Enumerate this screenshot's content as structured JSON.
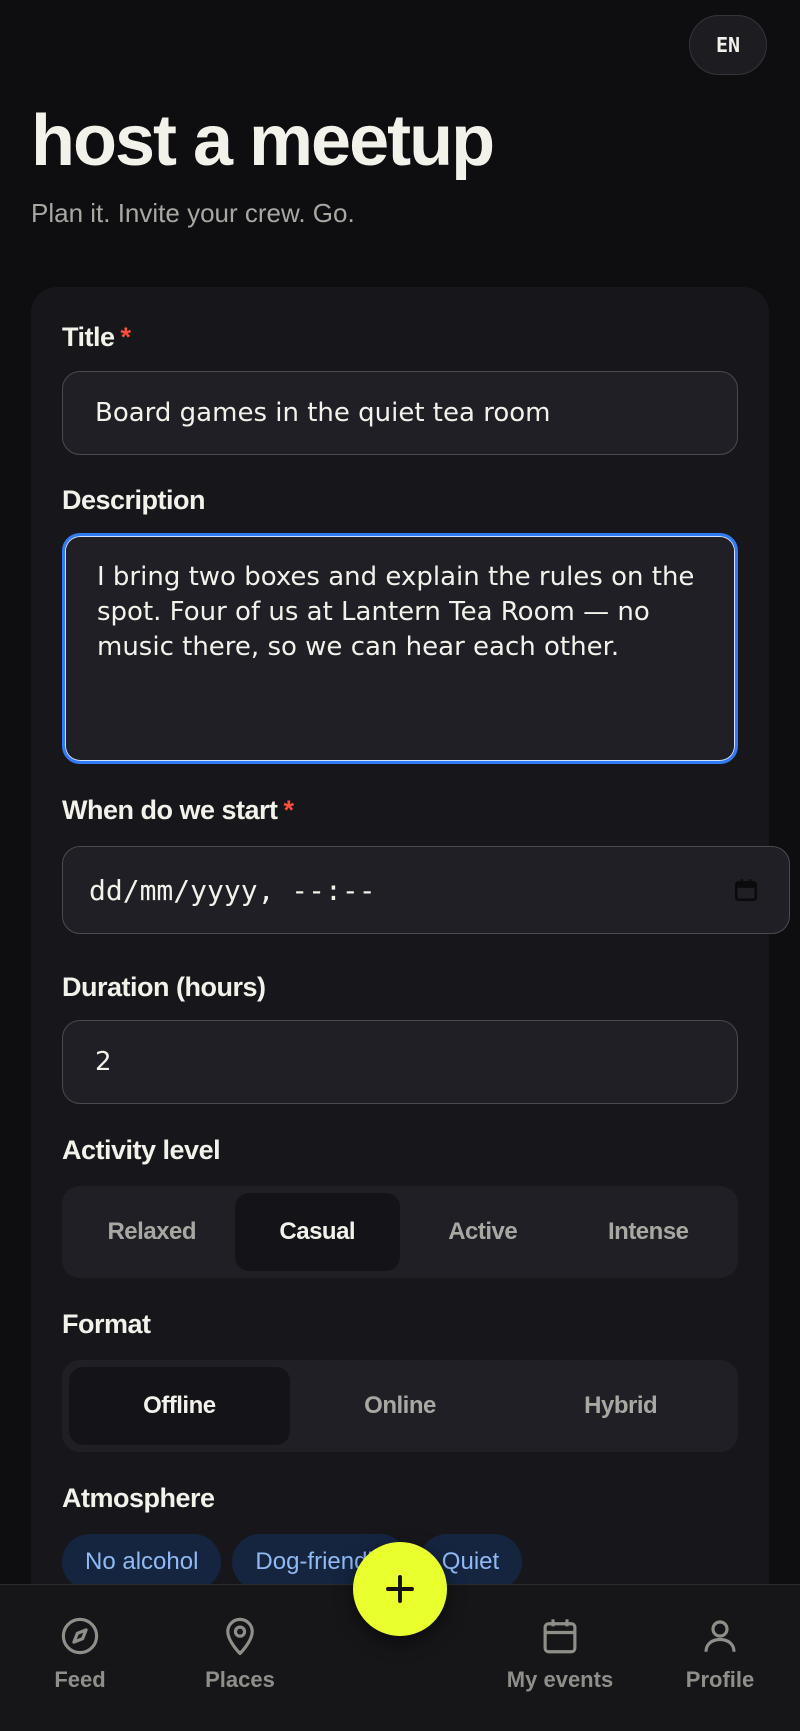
{
  "header": {
    "lang": "EN",
    "title": "host a meetup",
    "subtitle": "Plan it. Invite your crew. Go."
  },
  "form": {
    "title_label": "Title",
    "title_required": "*",
    "title_value": "Board games in the quiet tea room",
    "description_label": "Description",
    "description_value": "I bring two boxes and explain the rules on the spot. Four of us at Lantern Tea Room — no music there, so we can hear each other.",
    "start_label": "When do we start",
    "start_required": "*",
    "start_placeholder": "dd/mm/yyyy, --:--",
    "duration_label": "Duration (hours)",
    "duration_value": "2",
    "activity_label": "Activity level",
    "activity_options": [
      "Relaxed",
      "Casual",
      "Active",
      "Intense"
    ],
    "activity_selected": "Casual",
    "format_label": "Format",
    "format_options": [
      "Offline",
      "Online",
      "Hybrid"
    ],
    "format_selected": "Offline",
    "atmosphere_label": "Atmosphere",
    "atmosphere_chips": [
      "No alcohol",
      "Dog-friendly",
      "Quiet"
    ]
  },
  "nav": {
    "items": [
      {
        "label": "Feed",
        "icon": "compass-icon"
      },
      {
        "label": "Places",
        "icon": "map-pin-icon"
      },
      {
        "label": "My events",
        "icon": "calendar-icon"
      },
      {
        "label": "Profile",
        "icon": "user-icon"
      }
    ],
    "fab_icon": "plus-icon"
  },
  "colors": {
    "accent": "#e9ff2e",
    "focus": "#2f7cf6",
    "required": "#ff4e3a",
    "chip_text": "#8fbaf4"
  }
}
